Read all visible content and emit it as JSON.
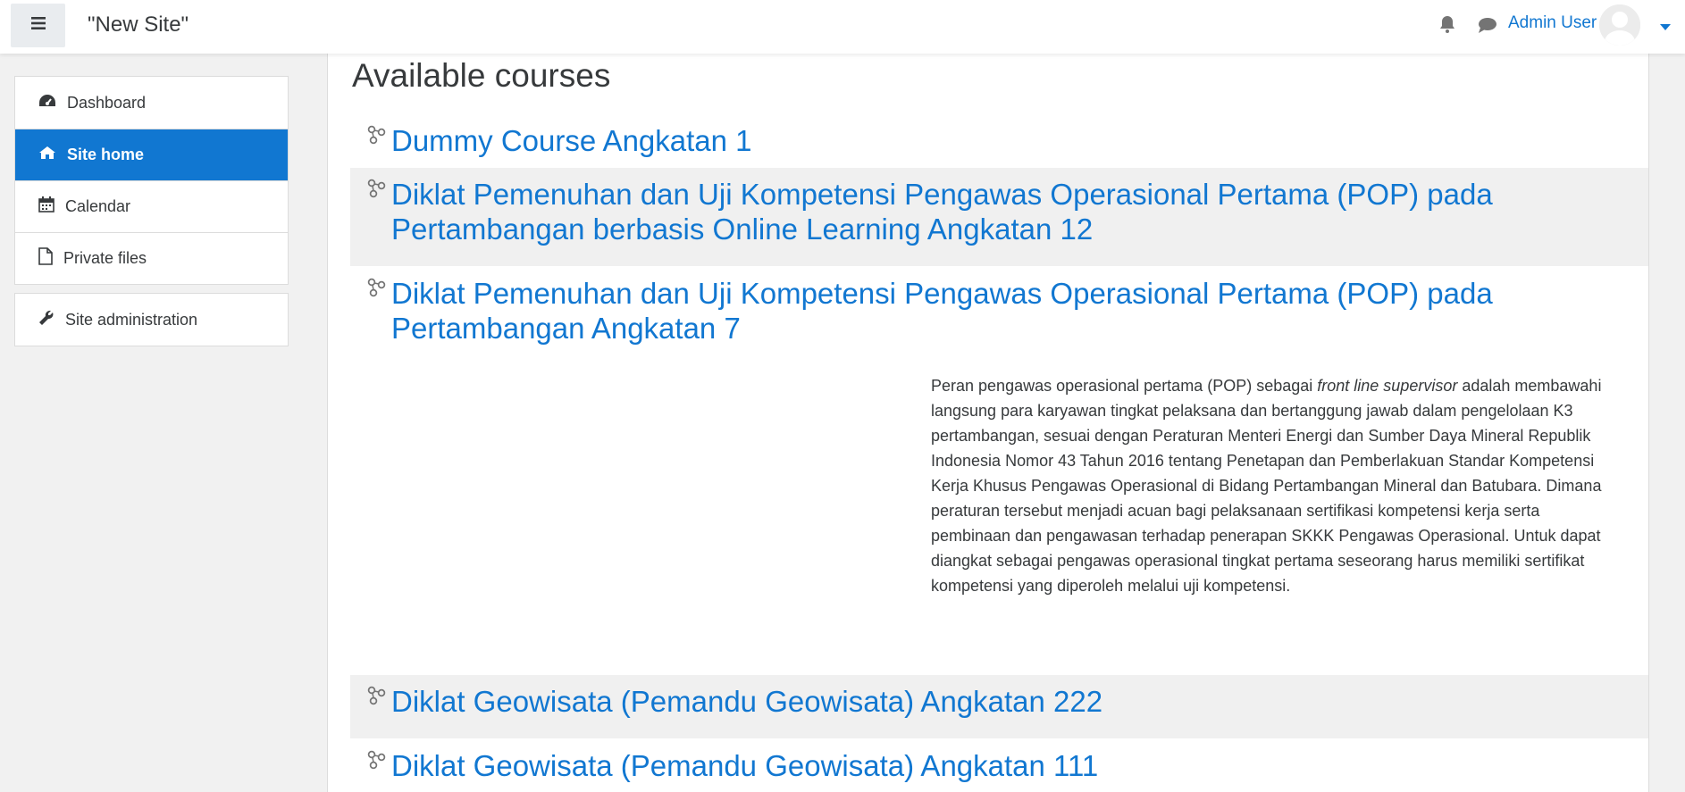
{
  "header": {
    "site_name": "\"New Site\"",
    "user_name": "Admin User",
    "icons": [
      "hamburger-icon",
      "bell-icon",
      "comment-icon",
      "avatar",
      "caret-down-icon"
    ]
  },
  "sidebar": {
    "items": [
      {
        "label": "Dashboard",
        "icon": "dashboard-icon"
      },
      {
        "label": "Site home",
        "icon": "home-icon",
        "active": true
      },
      {
        "label": "Calendar",
        "icon": "calendar-icon"
      },
      {
        "label": "Private files",
        "icon": "file-icon"
      }
    ],
    "admin": {
      "label": "Site administration",
      "icon": "wrench-icon"
    }
  },
  "main": {
    "heading": "Available courses",
    "courses": [
      {
        "title": "Dummy Course Angkatan 1"
      },
      {
        "title": "Diklat Pemenuhan dan Uji Kompetensi Pengawas Operasional Pertama (POP) pada Pertambangan berbasis Online Learning Angkatan 12"
      },
      {
        "title": "Diklat Pemenuhan dan Uji Kompetensi Pengawas Operasional Pertama (POP) pada Pertambangan Angkatan 7"
      },
      {
        "title": "Diklat Geowisata (Pemandu Geowisata) Angkatan 222"
      },
      {
        "title": "Diklat Geowisata (Pemandu Geowisata) Angkatan 111"
      }
    ],
    "summary": {
      "before": "Peran pengawas operasional pertama (POP) sebagai ",
      "italic": "front line supervisor",
      "after": " adalah membawahi langsung para karyawan tingkat pelaksana dan bertanggung jawab dalam pengelolaan K3 pertambangan, sesuai dengan Peraturan Menteri Energi dan Sumber Daya Mineral Republik Indonesia Nomor 43 Tahun 2016 tentang Penetapan dan Pemberlakuan Standar Kompetensi Kerja Khusus Pengawas Operasional di Bidang Pertambangan Mineral dan Batubara. Dimana peraturan tersebut menjadi acuan bagi pelaksanaan sertifikasi kompetensi kerja serta pembinaan dan pengawasan terhadap penerapan SKKK Pengawas Operasional. Untuk dapat diangkat sebagai pengawas operasional tingkat pertama seseorang harus memiliki sertifikat kompetensi yang diperoleh melalui uji kompetensi."
    }
  },
  "colors": {
    "accent": "#1177d1",
    "text": "#373a3c",
    "page_bg": "#f1f1f1",
    "stripe": "#f0f0f0"
  }
}
